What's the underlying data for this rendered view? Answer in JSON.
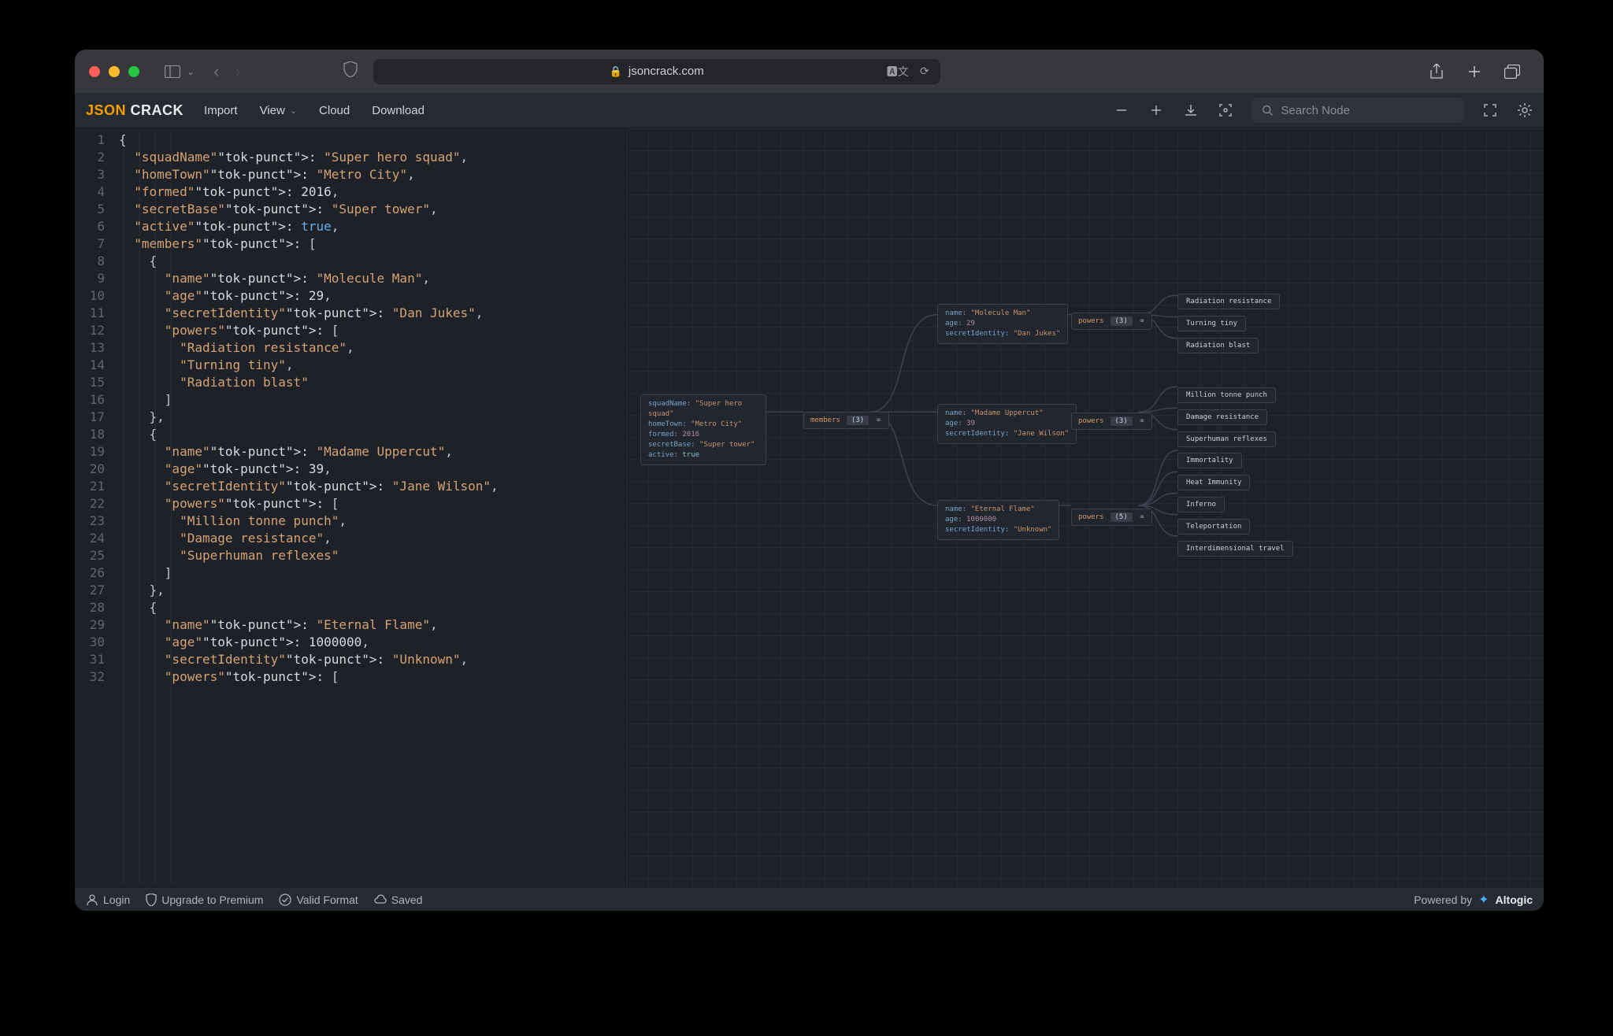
{
  "browser": {
    "url": "jsoncrack.com"
  },
  "brand": {
    "part1": "JSON",
    "part2": "CRACK"
  },
  "menu": {
    "import": "Import",
    "view": "View",
    "cloud": "Cloud",
    "download": "Download"
  },
  "search": {
    "placeholder": "Search Node"
  },
  "statusbar": {
    "login": "Login",
    "upgrade": "Upgrade to Premium",
    "valid": "Valid Format",
    "saved": "Saved",
    "powered": "Powered by",
    "altogic": "Altogic"
  },
  "editor_lines": [
    "{",
    "  \"squadName\": \"Super hero squad\",",
    "  \"homeTown\": \"Metro City\",",
    "  \"formed\": 2016,",
    "  \"secretBase\": \"Super tower\",",
    "  \"active\": true,",
    "  \"members\": [",
    "    {",
    "      \"name\": \"Molecule Man\",",
    "      \"age\": 29,",
    "      \"secretIdentity\": \"Dan Jukes\",",
    "      \"powers\": [",
    "        \"Radiation resistance\",",
    "        \"Turning tiny\",",
    "        \"Radiation blast\"",
    "      ]",
    "    },",
    "    {",
    "      \"name\": \"Madame Uppercut\",",
    "      \"age\": 39,",
    "      \"secretIdentity\": \"Jane Wilson\",",
    "      \"powers\": [",
    "        \"Million tonne punch\",",
    "        \"Damage resistance\",",
    "        \"Superhuman reflexes\"",
    "      ]",
    "    },",
    "    {",
    "      \"name\": \"Eternal Flame\",",
    "      \"age\": 1000000,",
    "      \"secretIdentity\": \"Unknown\",",
    "      \"powers\": ["
  ],
  "graph": {
    "root": {
      "squadName": "\"Super hero squad\"",
      "homeTown": "\"Metro City\"",
      "formed": "2016",
      "secretBase": "\"Super tower\"",
      "active": "true"
    },
    "members_label": "members",
    "members_count": "(3)",
    "powers_label": "powers",
    "member1": {
      "name": "\"Molecule Man\"",
      "age": "29",
      "secretIdentity": "\"Dan Jukes\"",
      "powers_count": "(3)"
    },
    "member2": {
      "name": "\"Madame Uppercut\"",
      "age": "39",
      "secretIdentity": "\"Jane Wilson\"",
      "powers_count": "(3)"
    },
    "member3": {
      "name": "\"Eternal Flame\"",
      "age": "1000000",
      "secretIdentity": "\"Unknown\"",
      "powers_count": "(5)"
    },
    "leaves1": [
      "Radiation resistance",
      "Turning tiny",
      "Radiation blast"
    ],
    "leaves2": [
      "Million tonne punch",
      "Damage resistance",
      "Superhuman reflexes"
    ],
    "leaves3": [
      "Immortality",
      "Heat Immunity",
      "Inferno",
      "Teleportation",
      "Interdimensional travel"
    ]
  }
}
